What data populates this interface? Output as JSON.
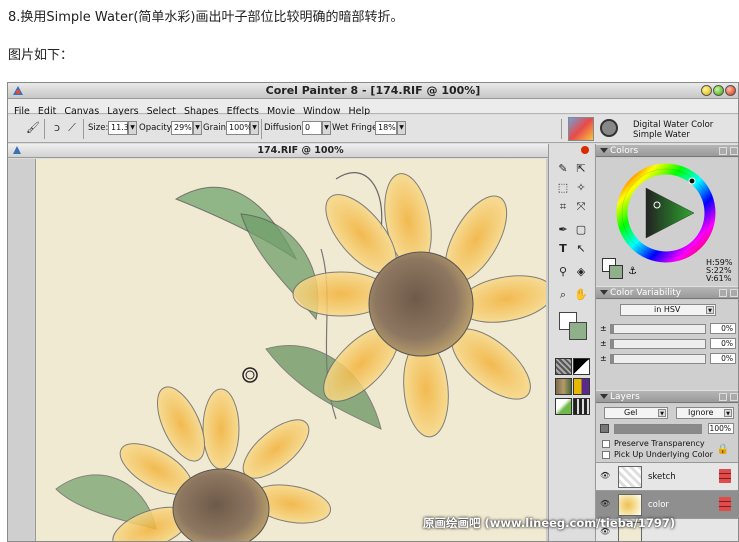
{
  "captions": {
    "step": "8.换用Simple Water(简单水彩)画出叶子部位比较明确的暗部转折。",
    "image_label": "图片如下："
  },
  "app": {
    "title": "Corel Painter 8 - [174.RIF @ 100%]",
    "menu": [
      "File",
      "Edit",
      "Canvas",
      "Layers",
      "Select",
      "Shapes",
      "Effects",
      "Movie",
      "Window",
      "Help"
    ]
  },
  "property_bar": {
    "size_label": "Size:",
    "size_value": "11.3",
    "opacity_label": "Opacity:",
    "opacity_value": "29%",
    "grain_label": "Grain:",
    "grain_value": "100%",
    "diffusion_label": "Diffusion:",
    "diffusion_value": "0",
    "wet_fringe_label": "Wet Fringe:",
    "wet_fringe_value": "18%",
    "brush_category": "Digital Water Color",
    "brush_variant": "Simple Water"
  },
  "document": {
    "title": "174.RIF @ 100%"
  },
  "colors_panel": {
    "title": "Colors",
    "h": "H:59%",
    "s": "S:22%",
    "v": "V:61%",
    "primary_color": "#ffffff",
    "secondary_color": "#8fb08a"
  },
  "variability_panel": {
    "title": "Color Variability",
    "mode": "in HSV",
    "rows": [
      {
        "prefix": "±",
        "value": "0%"
      },
      {
        "prefix": "±",
        "value": "0%"
      },
      {
        "prefix": "±",
        "value": "0%"
      }
    ]
  },
  "layers_panel": {
    "title": "Layers",
    "composite_method": "Gel",
    "composite_depth": "Ignore",
    "opacity_value": "100%",
    "preserve_transparency": "Preserve Transparency",
    "pick_up_underlying": "Pick Up Underlying Color",
    "layers": [
      {
        "name": "sketch",
        "selected": false
      },
      {
        "name": "color",
        "selected": true
      },
      {
        "name": "",
        "selected": false
      }
    ]
  },
  "watermark": "原画绘画吧 (www.lineeg.com/tieba/1797)"
}
